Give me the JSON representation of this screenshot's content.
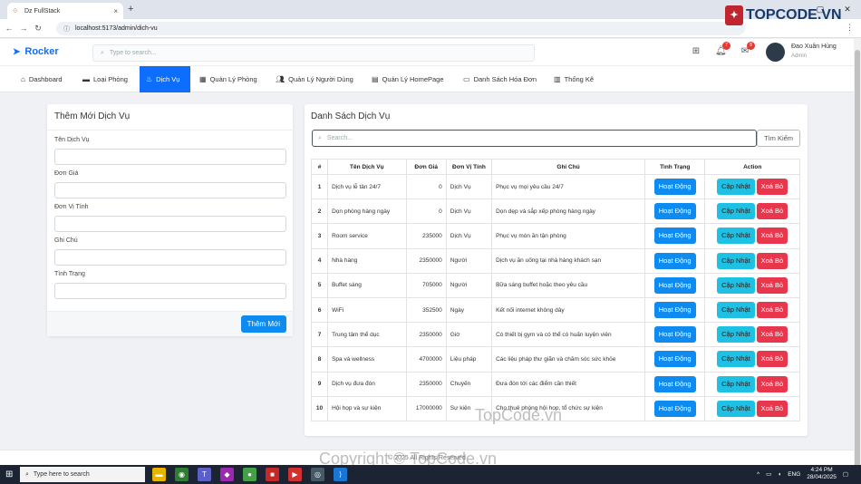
{
  "browser": {
    "tab_title": "Dz FullStack",
    "url": "localhost:5173/admin/dich-vu"
  },
  "header": {
    "brand": "Rocker",
    "search_placeholder": "Type to search...",
    "notif_count": "7",
    "msg_count": "8",
    "user_name": "Đao Xuân Hùng",
    "user_role": "Admin"
  },
  "nav": {
    "items": [
      {
        "label": "Dashboard",
        "icon": "home-icon"
      },
      {
        "label": "Loại Phòng",
        "icon": "bed-icon"
      },
      {
        "label": "Dịch Vụ",
        "icon": "service-icon",
        "active": true
      },
      {
        "label": "Quản Lý Phòng",
        "icon": "building-icon"
      },
      {
        "label": "Quản Lý Người Dùng",
        "icon": "users-icon"
      },
      {
        "label": "Quản Lý HomePage",
        "icon": "layers-icon"
      },
      {
        "label": "Danh Sách Hóa Đơn",
        "icon": "invoice-icon"
      },
      {
        "label": "Thống Kê",
        "icon": "chart-icon"
      }
    ]
  },
  "form": {
    "title": "Thêm Mới Dịch Vụ",
    "fields": {
      "ten": "Tên Dịch Vụ",
      "gia": "Đơn Giá",
      "dvt": "Đơn Vị Tính",
      "ghichu": "Ghi Chú",
      "tinhtrang": "Tình Trạng"
    },
    "submit": "Thêm Mới"
  },
  "list": {
    "title": "Danh Sách Dịch Vụ",
    "search_placeholder": "Search...",
    "search_button": "Tìm Kiếm",
    "columns": [
      "#",
      "Tên Dịch Vụ",
      "Đơn Giá",
      "Đơn Vị Tính",
      "Ghi Chú",
      "Tình Trạng",
      "Action"
    ],
    "status_label": "Hoạt Động",
    "update_label": "Cập Nhật",
    "delete_label": "Xoá Bỏ",
    "rows": [
      [
        "1",
        "Dịch vụ lễ tân 24/7",
        "0",
        "Dịch Vụ",
        "Phục vụ mọi yêu cầu 24/7"
      ],
      [
        "2",
        "Dọn phòng hàng ngày",
        "0",
        "Dịch Vụ",
        "Dọn dẹp và sắp xếp phòng hàng ngày"
      ],
      [
        "3",
        "Room service",
        "235000",
        "Dịch Vụ",
        "Phục vụ món ăn tận phòng"
      ],
      [
        "4",
        "Nhà hàng",
        "2350000",
        "Người",
        "Dịch vụ ăn uống tại nhà hàng khách sạn"
      ],
      [
        "5",
        "Buffet sáng",
        "705000",
        "Người",
        "Bữa sáng buffet hoặc theo yêu cầu"
      ],
      [
        "6",
        "WiFi",
        "352500",
        "Ngày",
        "Kết nối internet không dây"
      ],
      [
        "7",
        "Trung tâm thể dục",
        "2350000",
        "Giờ",
        "Có thiết bị gym và có thể có huấn luyện viên"
      ],
      [
        "8",
        "Spa và wellness",
        "4700000",
        "Liệu pháp",
        "Các liệu pháp thư giãn và chăm sóc sức khỏe"
      ],
      [
        "9",
        "Dịch vụ đưa đón",
        "2350000",
        "Chuyến",
        "Đưa đón tới các điểm cần thiết"
      ],
      [
        "10",
        "Hội họp và sự kiện",
        "17000000",
        "Sự kiện",
        "Cho thuê phòng hội họp, tổ chức sự kiện"
      ]
    ]
  },
  "footer": {
    "text": "© 2025 All Rights Reserved"
  },
  "watermark": {
    "logo": "TOPCODE.VN",
    "text1": "TopCode.vn",
    "text2": "Copyright © TopCode.vn"
  },
  "taskbar": {
    "search": "Type here to search",
    "lang": "ENG",
    "time": "4:24 PM",
    "date": "28/04/2025"
  }
}
